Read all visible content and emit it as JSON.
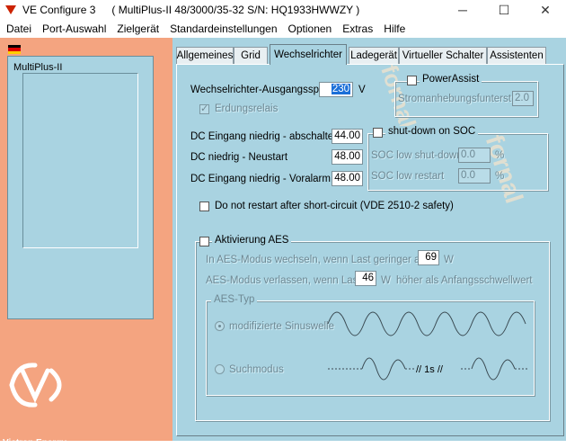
{
  "window": {
    "app_title": "VE Configure 3",
    "device_title": "( MultiPlus-II 48/3000/35-32 S/N: HQ1933HWWZY )",
    "minimize": "─",
    "maximize": "☐",
    "close": "✕"
  },
  "menu": [
    "Datei",
    "Port-Auswahl",
    "Zielgerät",
    "Standardeinstellungen",
    "Optionen",
    "Extras",
    "Hilfe"
  ],
  "device_panel": {
    "label": "MultiPlus-II",
    "brand": "Victron Energy"
  },
  "tabs": [
    "Allgemeines",
    "Grid",
    "Wechselrichter",
    "Ladegerät",
    "Virtueller Schalter",
    "Assistenten"
  ],
  "active_tab": "Wechselrichter",
  "inverter": {
    "output_voltage_label": "Wechselrichter-Ausgangssp.",
    "output_voltage_value": "230",
    "output_voltage_unit": "V",
    "ground_relay_label": "Erdungsrelais",
    "dc_shutdown_label": "DC Eingang niedrig - abschalten",
    "dc_shutdown_value": "44.00",
    "dc_restart_label": "DC niedrig - Neustart",
    "dc_restart_value": "48.00",
    "dc_prealarm_label": "DC Eingang niedrig - Voralarm",
    "dc_prealarm_value": "48.00",
    "no_restart_label": "Do not restart after short-circuit (VDE 2510-2 safety)"
  },
  "power_assist": {
    "title": "PowerAssist",
    "boost_label": "Stromanhebungsfunterst.",
    "boost_value": "2.0"
  },
  "soc": {
    "title": "shut-down on SOC",
    "low_shutdown_label": "SOC low shut-down",
    "low_shutdown_value": "0.0",
    "low_restart_label": "SOC low restart",
    "low_restart_value": "0.0",
    "unit": "%"
  },
  "aes": {
    "title": "Aktivierung AES",
    "enter_label": "In AES-Modus wechseln, wenn Last geringer als",
    "enter_value": "69",
    "enter_unit": "W",
    "leave_label": "AES-Modus verlassen, wenn Last",
    "leave_value": "46",
    "leave_unit": "W",
    "leave_suffix": "höher als Anfangsschwellwert",
    "type_title": "AES-Typ",
    "mode_modified_sine": "modifizierte Sinuswelle",
    "mode_search": "Suchmodus",
    "search_interval": "// 1s //"
  }
}
